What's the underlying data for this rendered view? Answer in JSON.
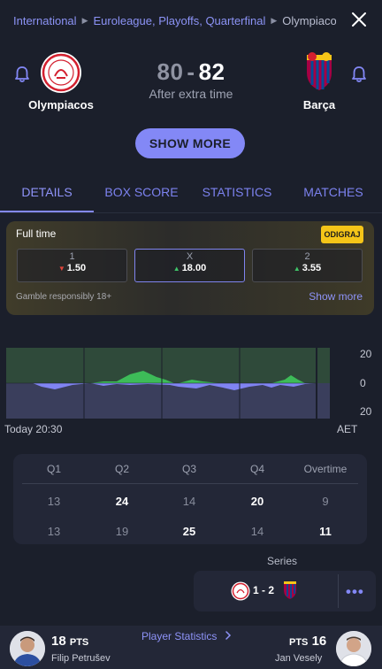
{
  "header": {
    "breadcrumbs": [
      "International",
      "Euroleague, Playoffs, Quarterfinal",
      "Olympiaco…"
    ]
  },
  "match": {
    "home": {
      "name": "Olympiacos",
      "score": "80"
    },
    "away": {
      "name": "Barça",
      "score": "82"
    },
    "score_separator": "-",
    "status": "After extra time"
  },
  "show_more_label": "SHOW MORE",
  "tabs": [
    {
      "label": "DETAILS",
      "active": true
    },
    {
      "label": "BOX SCORE",
      "active": false
    },
    {
      "label": "STATISTICS",
      "active": false
    },
    {
      "label": "MATCHES",
      "active": false
    }
  ],
  "odds": {
    "title": "Full time",
    "badge": "ODIGRAJ",
    "options": [
      {
        "label": "1",
        "value": "1.50",
        "trend": "down"
      },
      {
        "label": "X",
        "value": "18.00",
        "trend": "up"
      },
      {
        "label": "2",
        "value": "3.55",
        "trend": "up"
      }
    ],
    "disclaimer": "Gamble responsibly 18+",
    "show_more": "Show more"
  },
  "momentum": {
    "axis_labels": [
      "20",
      "0",
      "20"
    ],
    "start_label": "Today 20:30",
    "end_label": "AET",
    "colors": {
      "home": "#3dbb58",
      "away": "#8084f2",
      "background": "#2f4a3a"
    }
  },
  "quarters": {
    "headers": [
      "Q1",
      "Q2",
      "Q3",
      "Q4",
      "Overtime"
    ],
    "home": [
      "13",
      "24",
      "14",
      "20",
      "9"
    ],
    "away": [
      "13",
      "19",
      "25",
      "14",
      "11"
    ]
  },
  "series": {
    "label": "Series",
    "score": "1 - 2"
  },
  "player_stats": {
    "link": "Player Statistics",
    "home_player": {
      "pts": "18",
      "pts_label": "PTS",
      "name": "Filip Petrušev"
    },
    "away_player": {
      "pts": "16",
      "pts_label": "PTS",
      "name": "Jan Vesely"
    }
  }
}
